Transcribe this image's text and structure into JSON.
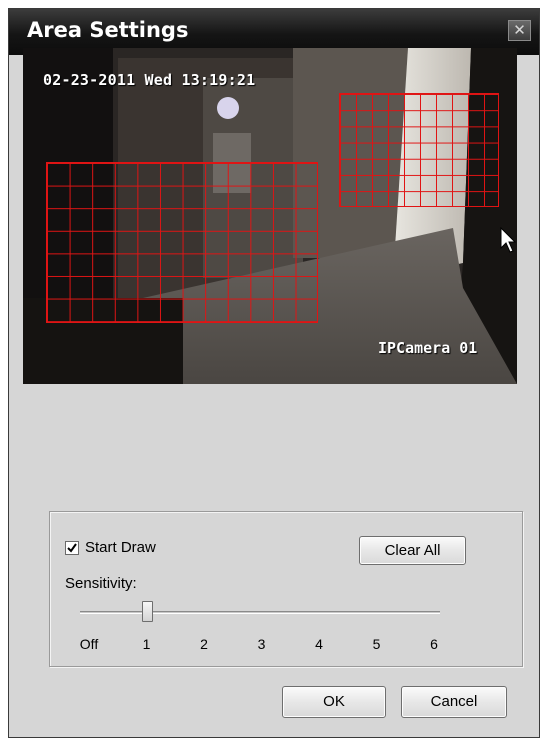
{
  "window": {
    "title": "Area Settings",
    "close_glyph": "✕"
  },
  "video": {
    "timestamp": "02-23-2011 Wed 13:19:21",
    "camera_name": "IPCamera 01",
    "detection_color": "#e01414"
  },
  "controls": {
    "start_draw_label": "Start Draw",
    "start_draw_checked": true,
    "clear_all_label": "Clear All",
    "sensitivity_label": "Sensitivity:",
    "sensitivity_ticks": [
      "Off",
      "1",
      "2",
      "3",
      "4",
      "5",
      "6"
    ],
    "sensitivity_value": "1"
  },
  "footer": {
    "ok_label": "OK",
    "cancel_label": "Cancel"
  },
  "icons": {
    "close": "close-icon",
    "check": "checkmark-icon",
    "cursor": "mouse-cursor-icon"
  }
}
